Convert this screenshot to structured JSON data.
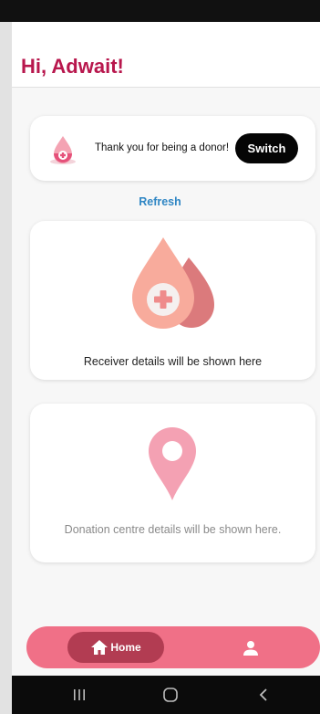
{
  "header": {
    "greeting": "Hi, Adwait!"
  },
  "donor_card": {
    "message": "Thank you for being a donor!",
    "switch_label": "Switch",
    "icon": "blood-drop-plus-icon"
  },
  "refresh_label": "Refresh",
  "receiver_card": {
    "message": "Receiver details will be shown here",
    "icon": "blood-drops-icon"
  },
  "centre_card": {
    "message": "Donation centre details will be shown here.",
    "icon": "location-pin-icon"
  },
  "bottom_nav": {
    "home_label": "Home",
    "active_tab": "home"
  },
  "colors": {
    "accent": "#b8174d",
    "nav": "#f07087",
    "nav_active": "#b23c52",
    "link": "#2f86c4"
  }
}
